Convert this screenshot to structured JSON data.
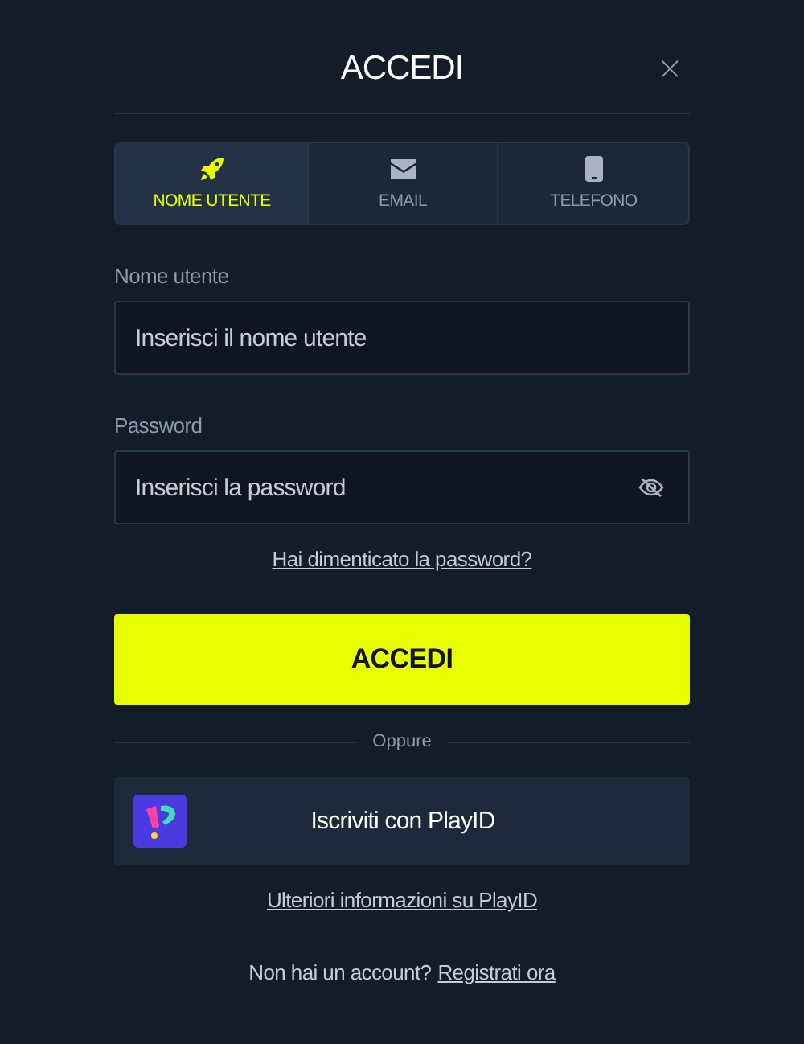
{
  "dialog": {
    "title": "ACCEDI",
    "close": "×"
  },
  "tabs": [
    {
      "label": "NOME UTENTE",
      "kind": "username",
      "selected": true
    },
    {
      "label": "EMAIL",
      "kind": "email",
      "selected": false
    },
    {
      "label": "TELEFONO",
      "kind": "phone",
      "selected": false
    }
  ],
  "fields": [
    {
      "label": "Nome utente",
      "placeholder": "Inserisci il nome utente",
      "kind": "text"
    },
    {
      "label": "Password",
      "placeholder": "Inserisci la password",
      "kind": "password"
    }
  ],
  "forgot_link": "Hai dimenticato la password?",
  "submit": "ACCEDI",
  "divider": "Oppure",
  "playid_button": "Iscriviti con PlayID",
  "playid_link": "Ulteriori informazioni su PlayID",
  "footer": {
    "text": "Non hai un account?",
    "link": "Registrati ora"
  }
}
